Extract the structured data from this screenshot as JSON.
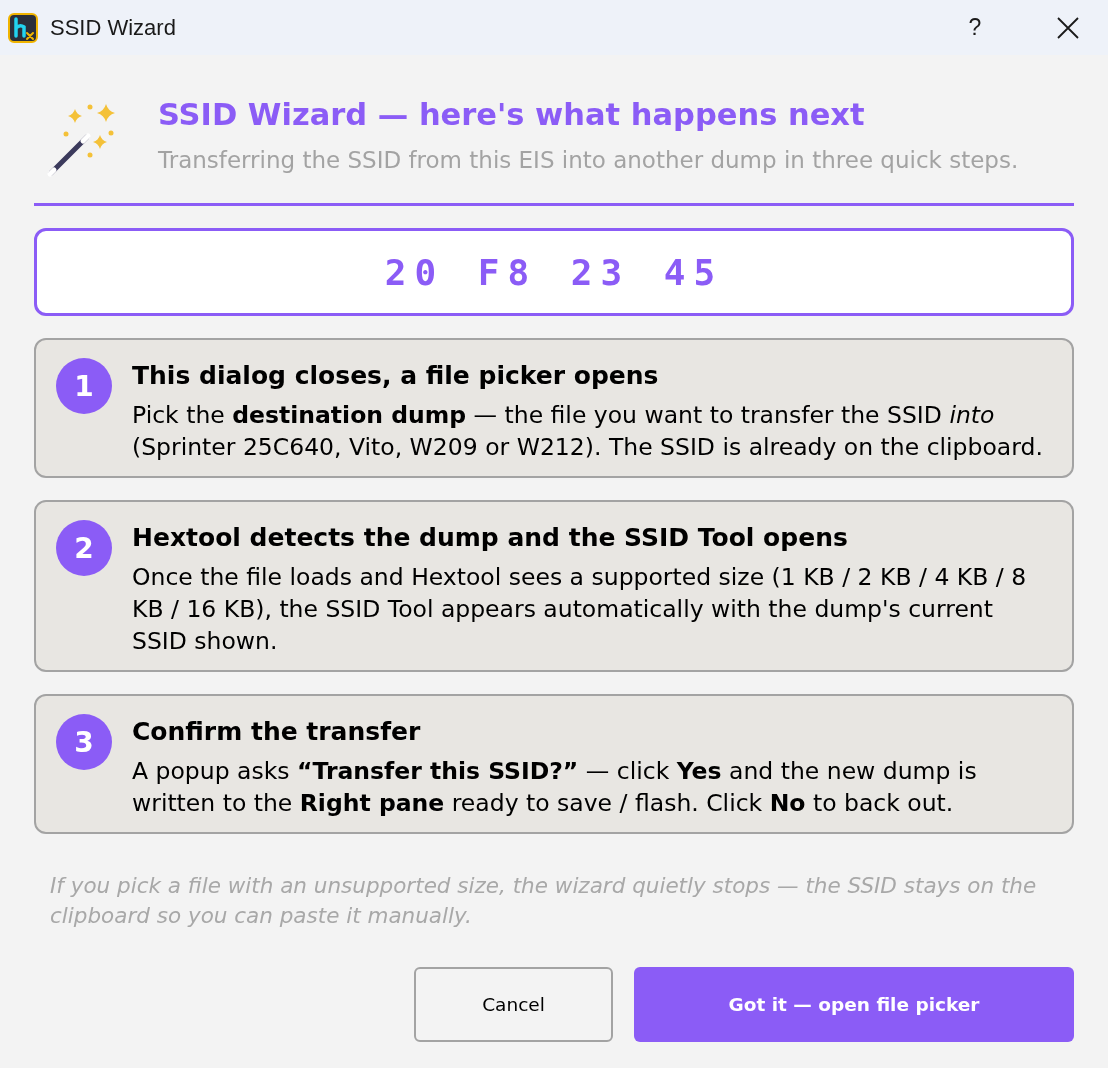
{
  "window": {
    "title": "SSID Wizard",
    "help": "?"
  },
  "header": {
    "title": "SSID Wizard — here's what happens next",
    "subtitle": "Transferring the SSID from this EIS into another dump in three quick steps."
  },
  "ssid": "20 F8 23 45",
  "steps": [
    {
      "number": "1",
      "title": "This dialog closes, a file picker opens",
      "body": "Pick the **destination dump** — the file you want to transfer the SSID *into* (Sprinter 25C640, Vito, W209 or W212). The SSID is already on the clipboard."
    },
    {
      "number": "2",
      "title": "Hextool detects the dump and the SSID Tool opens",
      "body": "Once the file loads and Hextool sees a supported size (1 KB / 2 KB / 4 KB / 8 KB / 16 KB), the SSID Tool appears automatically with the dump's current SSID shown."
    },
    {
      "number": "3",
      "title": "Confirm the transfer",
      "body": "A popup asks **“Transfer this SSID?”** — click **Yes** and the new dump is written to the **Right pane** ready to save / flash. Click **No** to back out."
    }
  ],
  "footnote": "If you pick a file with an unsupported size, the wizard quietly stops — the SSID stays on the clipboard so you can paste it manually.",
  "buttons": [
    {
      "label": "Cancel",
      "kind": "secondary"
    },
    {
      "label": "Got it — open file picker",
      "kind": "primary"
    }
  ]
}
